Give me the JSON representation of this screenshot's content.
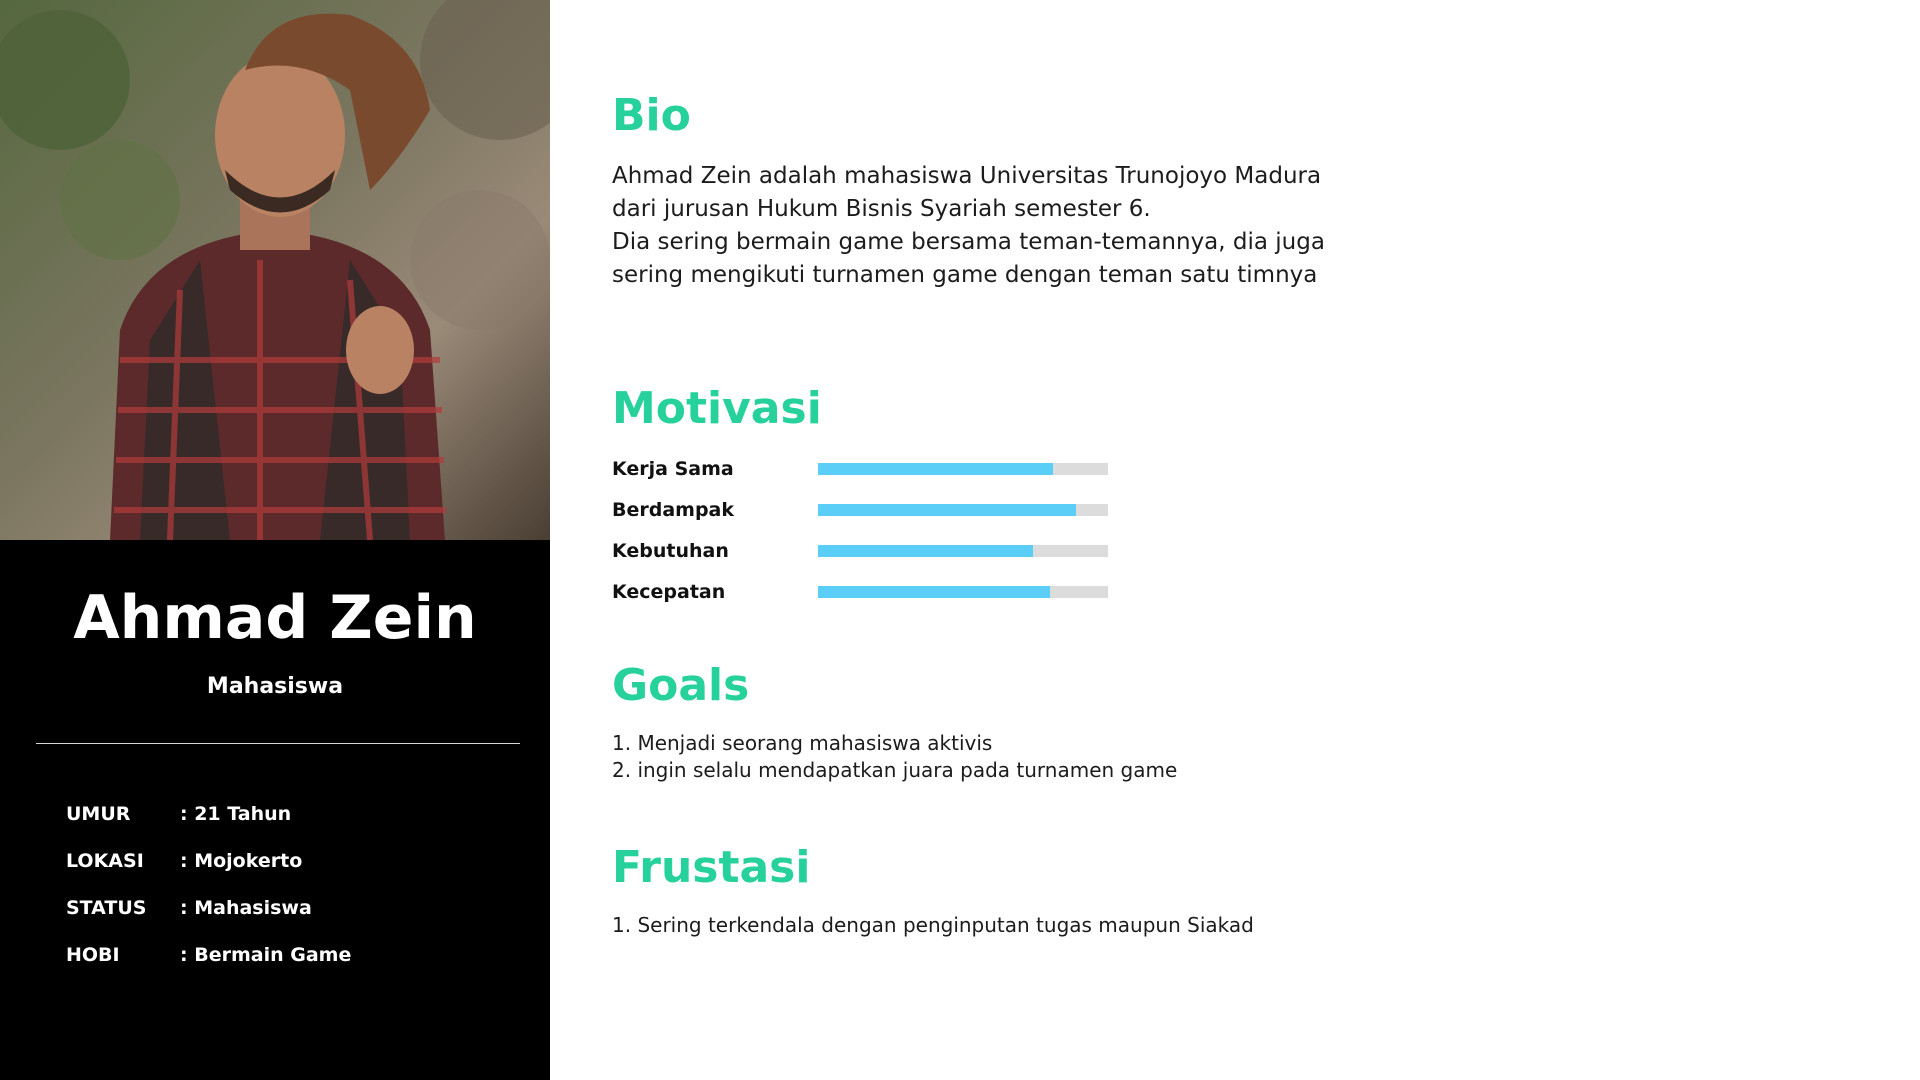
{
  "profile": {
    "name": "Ahmad Zein",
    "role": "Mahasiswa",
    "photo_icon": "person-photo",
    "info": [
      {
        "key": "UMUR",
        "value": ": 21 Tahun"
      },
      {
        "key": "LOKASI",
        "value": ": Mojokerto"
      },
      {
        "key": "STATUS",
        "value": ": Mahasiswa"
      },
      {
        "key": "HOBI",
        "value": ": Bermain Game"
      }
    ]
  },
  "bio": {
    "heading": "Bio",
    "lines": [
      "Ahmad Zein adalah mahasiswa Universitas Trunojoyo Madura",
      "dari jurusan Hukum Bisnis Syariah semester 6.",
      "Dia sering bermain game bersama teman-temannya, dia juga",
      "sering mengikuti turnamen game dengan teman satu timnya"
    ]
  },
  "motivation": {
    "heading": "Motivasi",
    "items": [
      {
        "label": "Kerja Sama",
        "level": 0.81
      },
      {
        "label": "Berdampak",
        "level": 0.89
      },
      {
        "label": "Kebutuhan",
        "level": 0.74
      },
      {
        "label": "Kecepatan",
        "level": 0.8
      }
    ]
  },
  "goals": {
    "heading": "Goals",
    "items": [
      "1. Menjadi seorang mahasiswa aktivis",
      "2. ingin selalu mendapatkan juara pada turnamen game"
    ]
  },
  "frustration": {
    "heading": "Frustasi",
    "items": [
      "1. Sering terkendala dengan penginputan tugas maupun Siakad"
    ]
  },
  "colors": {
    "accent": "#27d19b",
    "bar_fill": "#5acef7",
    "bar_track": "#dcdcdc",
    "panel": "#000000"
  }
}
